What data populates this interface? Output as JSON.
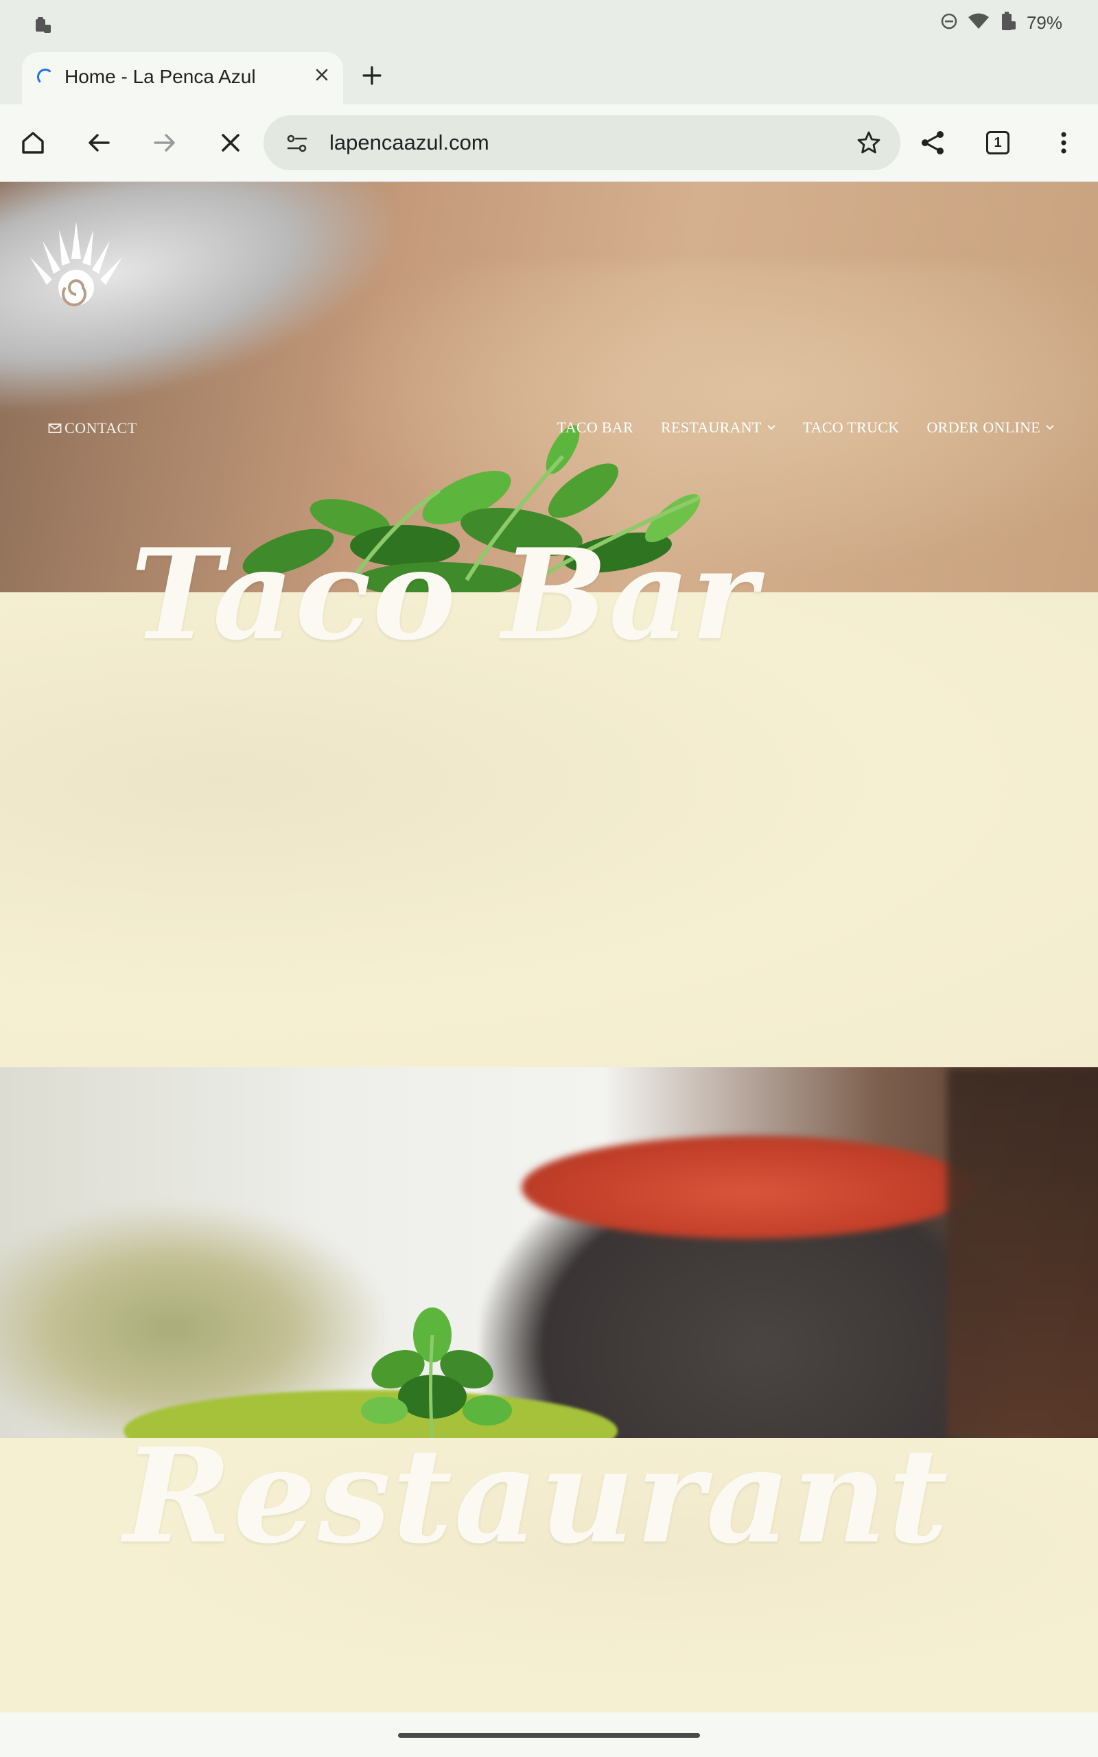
{
  "status_bar": {
    "battery_percent": "79%",
    "icons": [
      "clipboard-icon",
      "do-not-disturb-icon",
      "wifi-icon",
      "battery-icon"
    ]
  },
  "browser": {
    "tab_title": "Home - La Penca Azul",
    "tab_loading": true,
    "url": "lapencaazul.com",
    "tab_count": "1",
    "toolbar_icons": [
      "home-icon",
      "back-icon",
      "forward-icon",
      "stop-icon",
      "site-info-icon",
      "bookmark-star-icon",
      "share-icon",
      "tab-switcher-icon",
      "more-menu-icon"
    ]
  },
  "site": {
    "logo": "la-penca-azul-agave-logo",
    "contact_label": "CONTACT",
    "nav": [
      {
        "label": "TACO BAR",
        "has_dropdown": false
      },
      {
        "label": "RESTAURANT",
        "has_dropdown": true
      },
      {
        "label": "TACO TRUCK",
        "has_dropdown": false
      },
      {
        "label": "ORDER ONLINE",
        "has_dropdown": true
      }
    ],
    "sections": [
      {
        "title": "Taco Bar"
      },
      {
        "title": "Restaurant"
      }
    ]
  },
  "colors": {
    "cream_background": "#f6f0d2",
    "browser_chrome": "#e9ede8",
    "loading_spinner": "#1a73e8",
    "title_text": "#fbf9f1"
  }
}
